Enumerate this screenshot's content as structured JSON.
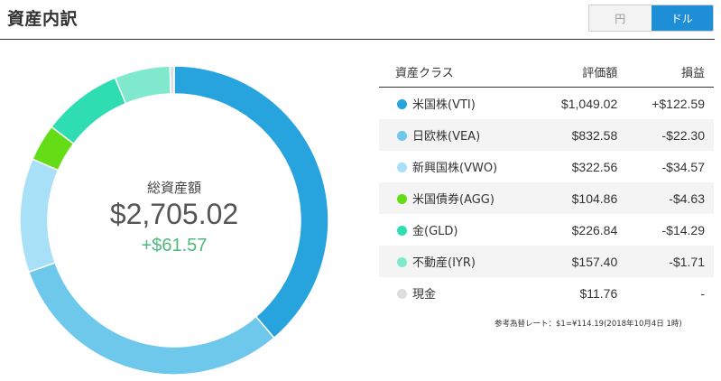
{
  "header": {
    "title": "資産内訳",
    "currency_toggle": {
      "yen_label": "円",
      "usd_label": "ドル",
      "selected": "ドル"
    }
  },
  "summary": {
    "label": "総資産額",
    "total": "$2,705.02",
    "gain": "+$61.57"
  },
  "table": {
    "headers": {
      "asset_class": "資産クラス",
      "value": "評価額",
      "pl": "損益"
    },
    "rows": [
      {
        "name": "米国株(VTI)",
        "value": "$1,049.02",
        "pl": "+$122.59",
        "sign": "pos",
        "color": "#27a3dd",
        "amount": 1049.02
      },
      {
        "name": "日欧株(VEA)",
        "value": "$832.58",
        "pl": "-$22.30",
        "sign": "neg",
        "color": "#6ec8ec",
        "amount": 832.58
      },
      {
        "name": "新興国株(VWO)",
        "value": "$322.56",
        "pl": "-$34.57",
        "sign": "neg",
        "color": "#a8e0f8",
        "amount": 322.56
      },
      {
        "name": "米国債券(AGG)",
        "value": "$104.86",
        "pl": "-$4.63",
        "sign": "neg",
        "color": "#64dd17",
        "amount": 104.86
      },
      {
        "name": "金(GLD)",
        "value": "$226.84",
        "pl": "-$14.29",
        "sign": "neg",
        "color": "#2fddb3",
        "amount": 226.84
      },
      {
        "name": "不動産(IYR)",
        "value": "$157.40",
        "pl": "-$1.71",
        "sign": "neg",
        "color": "#7fe8cd",
        "amount": 157.4
      },
      {
        "name": "現金",
        "value": "$11.76",
        "pl": "-",
        "sign": "neu",
        "color": "#dddddd",
        "amount": 11.76
      }
    ]
  },
  "footnote": "参考為替レート：$1=¥114.19(2018年10月4日 1時)"
}
